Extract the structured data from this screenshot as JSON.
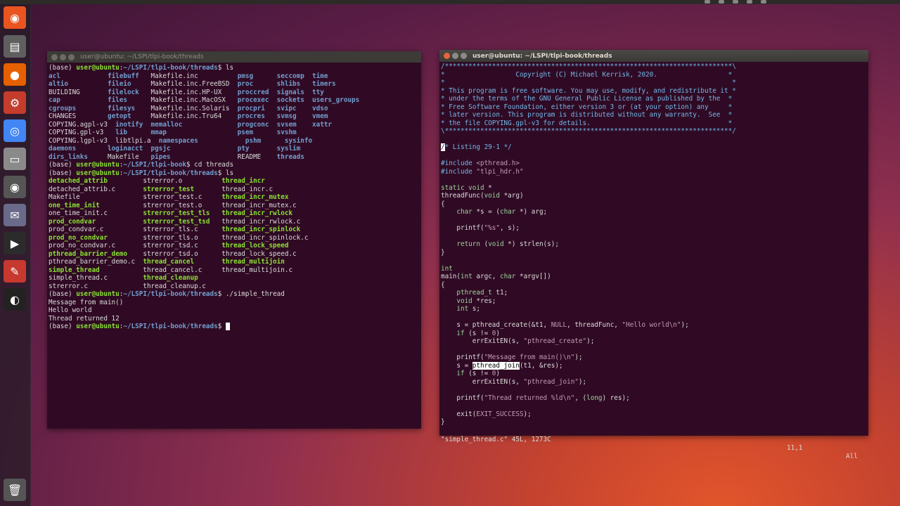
{
  "desktop": {
    "accent": "#e95420",
    "terminal_bg": "#300a24"
  },
  "launcher": {
    "items": [
      {
        "name": "ubuntu-dash-icon",
        "glyph": "◉"
      },
      {
        "name": "files-icon",
        "glyph": "▤"
      },
      {
        "name": "firefox-icon",
        "glyph": "●"
      },
      {
        "name": "settings-icon",
        "glyph": "⚙"
      },
      {
        "name": "chrome-icon",
        "glyph": "◎"
      },
      {
        "name": "drive-icon",
        "glyph": "▭"
      },
      {
        "name": "dvd-icon",
        "glyph": "◉"
      },
      {
        "name": "pidgin-icon",
        "glyph": "✉"
      },
      {
        "name": "terminal-icon",
        "glyph": "▶"
      },
      {
        "name": "text-editor-icon",
        "glyph": "✎"
      },
      {
        "name": "obs-icon",
        "glyph": "◐"
      },
      {
        "name": "trash-icon",
        "glyph": "🗑"
      }
    ]
  },
  "left_window": {
    "title": "user@ubuntu: ~/LSPI/tlpi-book/threads",
    "prompt_user": "user@ubuntu",
    "lines": [
      [
        {
          "c": "d",
          "t": "(base) "
        },
        {
          "c": "g",
          "t": "user@ubuntu"
        },
        {
          "c": "d",
          "t": ":"
        },
        {
          "c": "b",
          "t": "~/LSPI/tlpi-book/threads"
        },
        {
          "c": "d",
          "t": "$ ls"
        }
      ],
      [
        {
          "c": "b",
          "t": "acl            "
        },
        {
          "c": "b",
          "t": "filebuff   "
        },
        {
          "c": "d",
          "t": "Makefile.inc          "
        },
        {
          "c": "b",
          "t": "pmsg      "
        },
        {
          "c": "b",
          "t": "seccomp  "
        },
        {
          "c": "b",
          "t": "time"
        }
      ],
      [
        {
          "c": "b",
          "t": "altio          "
        },
        {
          "c": "b",
          "t": "fileio     "
        },
        {
          "c": "d",
          "t": "Makefile.inc.FreeBSD  "
        },
        {
          "c": "b",
          "t": "proc      "
        },
        {
          "c": "b",
          "t": "shlibs   "
        },
        {
          "c": "b",
          "t": "timers"
        }
      ],
      [
        {
          "c": "d",
          "t": "BUILDING       "
        },
        {
          "c": "b",
          "t": "filelock   "
        },
        {
          "c": "d",
          "t": "Makefile.inc.HP-UX    "
        },
        {
          "c": "b",
          "t": "proccred  "
        },
        {
          "c": "b",
          "t": "signals  "
        },
        {
          "c": "b",
          "t": "tty"
        }
      ],
      [
        {
          "c": "b",
          "t": "cap            "
        },
        {
          "c": "b",
          "t": "files      "
        },
        {
          "c": "d",
          "t": "Makefile.inc.MacOSX   "
        },
        {
          "c": "b",
          "t": "procexec  "
        },
        {
          "c": "b",
          "t": "sockets  "
        },
        {
          "c": "b",
          "t": "users_groups"
        }
      ],
      [
        {
          "c": "b",
          "t": "cgroups        "
        },
        {
          "c": "b",
          "t": "filesys    "
        },
        {
          "c": "d",
          "t": "Makefile.inc.Solaris  "
        },
        {
          "c": "b",
          "t": "procpri   "
        },
        {
          "c": "b",
          "t": "svipc    "
        },
        {
          "c": "b",
          "t": "vdso"
        }
      ],
      [
        {
          "c": "d",
          "t": "CHANGES        "
        },
        {
          "c": "b",
          "t": "getopt     "
        },
        {
          "c": "d",
          "t": "Makefile.inc.Tru64    "
        },
        {
          "c": "b",
          "t": "procres   "
        },
        {
          "c": "b",
          "t": "svmsg    "
        },
        {
          "c": "b",
          "t": "vmem"
        }
      ],
      [
        {
          "c": "d",
          "t": "COPYING.agpl-v3  "
        },
        {
          "c": "b",
          "t": "inotify  "
        },
        {
          "c": "b",
          "t": "memalloc              "
        },
        {
          "c": "b",
          "t": "progconc  "
        },
        {
          "c": "b",
          "t": "svsem    "
        },
        {
          "c": "b",
          "t": "xattr"
        }
      ],
      [
        {
          "c": "d",
          "t": "COPYING.gpl-v3   "
        },
        {
          "c": "b",
          "t": "lib      "
        },
        {
          "c": "b",
          "t": "mmap                  "
        },
        {
          "c": "b",
          "t": "psem      "
        },
        {
          "c": "b",
          "t": "svshm"
        }
      ],
      [
        {
          "c": "d",
          "t": "COPYING.lgpl-v3  "
        },
        {
          "c": "d",
          "t": "libtlpi.a  "
        },
        {
          "c": "b",
          "t": "namespaces            "
        },
        {
          "c": "b",
          "t": "pshm      "
        },
        {
          "c": "b",
          "t": "sysinfo"
        }
      ],
      [
        {
          "c": "b",
          "t": "daemons        "
        },
        {
          "c": "b",
          "t": "loginacct  "
        },
        {
          "c": "b",
          "t": "pgsjc                 "
        },
        {
          "c": "b",
          "t": "pty       "
        },
        {
          "c": "b",
          "t": "syslim"
        }
      ],
      [
        {
          "c": "b",
          "t": "dirs_links     "
        },
        {
          "c": "d",
          "t": "Makefile   "
        },
        {
          "c": "b",
          "t": "pipes                 "
        },
        {
          "c": "d",
          "t": "README    "
        },
        {
          "c": "b",
          "t": "threads"
        }
      ],
      [
        {
          "c": "d",
          "t": "(base) "
        },
        {
          "c": "g",
          "t": "user@ubuntu"
        },
        {
          "c": "d",
          "t": ":"
        },
        {
          "c": "b",
          "t": "~/LSPI/tlpi-book"
        },
        {
          "c": "d",
          "t": "$ cd threads"
        }
      ],
      [
        {
          "c": "d",
          "t": "(base) "
        },
        {
          "c": "g",
          "t": "user@ubuntu"
        },
        {
          "c": "d",
          "t": ":"
        },
        {
          "c": "b",
          "t": "~/LSPI/tlpi-book/threads"
        },
        {
          "c": "d",
          "t": "$ ls"
        }
      ],
      [
        {
          "c": "pl",
          "t": "detached_attrib         "
        },
        {
          "c": "d",
          "t": "strerror.o          "
        },
        {
          "c": "pl",
          "t": "thread_incr"
        }
      ],
      [
        {
          "c": "d",
          "t": "detached_attrib.c       "
        },
        {
          "c": "pl",
          "t": "strerror_test       "
        },
        {
          "c": "d",
          "t": "thread_incr.c"
        }
      ],
      [
        {
          "c": "d",
          "t": "Makefile                "
        },
        {
          "c": "d",
          "t": "strerror_test.c     "
        },
        {
          "c": "pl",
          "t": "thread_incr_mutex"
        }
      ],
      [
        {
          "c": "pl",
          "t": "one_time_init           "
        },
        {
          "c": "d",
          "t": "strerror_test.o     "
        },
        {
          "c": "d",
          "t": "thread_incr_mutex.c"
        }
      ],
      [
        {
          "c": "d",
          "t": "one_time_init.c         "
        },
        {
          "c": "pl",
          "t": "strerror_test_tls   "
        },
        {
          "c": "pl",
          "t": "thread_incr_rwlock"
        }
      ],
      [
        {
          "c": "pl",
          "t": "prod_condvar            "
        },
        {
          "c": "pl",
          "t": "strerror_test_tsd   "
        },
        {
          "c": "d",
          "t": "thread_incr_rwlock.c"
        }
      ],
      [
        {
          "c": "d",
          "t": "prod_condvar.c          "
        },
        {
          "c": "d",
          "t": "strerror_tls.c      "
        },
        {
          "c": "pl",
          "t": "thread_incr_spinlock"
        }
      ],
      [
        {
          "c": "pl",
          "t": "prod_no_condvar         "
        },
        {
          "c": "d",
          "t": "strerror_tls.o      "
        },
        {
          "c": "d",
          "t": "thread_incr_spinlock.c"
        }
      ],
      [
        {
          "c": "d",
          "t": "prod_no_condvar.c       "
        },
        {
          "c": "d",
          "t": "strerror_tsd.c      "
        },
        {
          "c": "pl",
          "t": "thread_lock_speed"
        }
      ],
      [
        {
          "c": "pl",
          "t": "pthread_barrier_demo    "
        },
        {
          "c": "d",
          "t": "strerror_tsd.o      "
        },
        {
          "c": "d",
          "t": "thread_lock_speed.c"
        }
      ],
      [
        {
          "c": "d",
          "t": "pthread_barrier_demo.c  "
        },
        {
          "c": "pl",
          "t": "thread_cancel       "
        },
        {
          "c": "pl",
          "t": "thread_multijoin"
        }
      ],
      [
        {
          "c": "pl",
          "t": "simple_thread           "
        },
        {
          "c": "d",
          "t": "thread_cancel.c     "
        },
        {
          "c": "d",
          "t": "thread_multijoin.c"
        }
      ],
      [
        {
          "c": "d",
          "t": "simple_thread.c         "
        },
        {
          "c": "pl",
          "t": "thread_cleanup"
        }
      ],
      [
        {
          "c": "d",
          "t": "strerror.c              "
        },
        {
          "c": "d",
          "t": "thread_cleanup.c"
        }
      ],
      [
        {
          "c": "d",
          "t": "(base) "
        },
        {
          "c": "g",
          "t": "user@ubuntu"
        },
        {
          "c": "d",
          "t": ":"
        },
        {
          "c": "b",
          "t": "~/LSPI/tlpi-book/threads"
        },
        {
          "c": "d",
          "t": "$ ./simple_thread"
        }
      ],
      [
        {
          "c": "d",
          "t": "Message from main()"
        }
      ],
      [
        {
          "c": "d",
          "t": "Hello world"
        }
      ],
      [
        {
          "c": "d",
          "t": "Thread returned 12"
        }
      ],
      [
        {
          "c": "d",
          "t": "(base) "
        },
        {
          "c": "g",
          "t": "user@ubuntu"
        },
        {
          "c": "d",
          "t": ":"
        },
        {
          "c": "b",
          "t": "~/LSPI/tlpi-book/threads"
        },
        {
          "c": "d",
          "t": "$ "
        },
        {
          "c": "cur",
          "t": " "
        }
      ]
    ]
  },
  "right_window": {
    "title": "user@ubuntu: ~/LSPI/tlpi-book/threads",
    "lines": [
      [
        {
          "c": "cm",
          "t": "/*************************************************************************\\"
        }
      ],
      [
        {
          "c": "cm",
          "t": "*                  Copyright (C) Michael Kerrisk, 2020.                  *"
        }
      ],
      [
        {
          "c": "cm",
          "t": "*                                                                         *"
        }
      ],
      [
        {
          "c": "cm",
          "t": "* This program is free software. You may use, modify, and redistribute it *"
        }
      ],
      [
        {
          "c": "cm",
          "t": "* under the terms of the GNU General Public License as published by the  *"
        }
      ],
      [
        {
          "c": "cm",
          "t": "* Free Software Foundation, either version 3 or (at your option) any     *"
        }
      ],
      [
        {
          "c": "cm",
          "t": "* later version. This program is distributed without any warranty.  See  *"
        }
      ],
      [
        {
          "c": "cm",
          "t": "* the file COPYING.gpl-v3 for details.                                   *"
        }
      ],
      [
        {
          "c": "cm",
          "t": "\\*************************************************************************/"
        }
      ],
      [
        {
          "c": "d",
          "t": ""
        }
      ],
      [
        {
          "c": "cur",
          "t": "/"
        },
        {
          "c": "cm",
          "t": "* Listing 29-1 */"
        }
      ],
      [
        {
          "c": "d",
          "t": ""
        }
      ],
      [
        {
          "c": "cm",
          "t": "#include "
        },
        {
          "c": "inc",
          "t": "<pthread.h>"
        }
      ],
      [
        {
          "c": "cm",
          "t": "#include "
        },
        {
          "c": "inc",
          "t": "\"tlpi_hdr.h\""
        }
      ],
      [
        {
          "c": "d",
          "t": ""
        }
      ],
      [
        {
          "c": "ty",
          "t": "static void"
        },
        {
          "c": "d",
          "t": " *"
        }
      ],
      [
        {
          "c": "d",
          "t": "threadFunc("
        },
        {
          "c": "ty",
          "t": "void"
        },
        {
          "c": "d",
          "t": " *arg)"
        }
      ],
      [
        {
          "c": "d",
          "t": "{"
        }
      ],
      [
        {
          "c": "d",
          "t": "    "
        },
        {
          "c": "ty",
          "t": "char"
        },
        {
          "c": "d",
          "t": " *s = ("
        },
        {
          "c": "ty",
          "t": "char"
        },
        {
          "c": "d",
          "t": " *) arg;"
        }
      ],
      [
        {
          "c": "d",
          "t": ""
        }
      ],
      [
        {
          "c": "d",
          "t": "    printf("
        },
        {
          "c": "str",
          "t": "\"%s\""
        },
        {
          "c": "d",
          "t": ", s);"
        }
      ],
      [
        {
          "c": "d",
          "t": ""
        }
      ],
      [
        {
          "c": "d",
          "t": "    "
        },
        {
          "c": "ty",
          "t": "return"
        },
        {
          "c": "d",
          "t": " ("
        },
        {
          "c": "ty",
          "t": "void"
        },
        {
          "c": "d",
          "t": " *) strlen(s);"
        }
      ],
      [
        {
          "c": "d",
          "t": "}"
        }
      ],
      [
        {
          "c": "d",
          "t": ""
        }
      ],
      [
        {
          "c": "ty",
          "t": "int"
        }
      ],
      [
        {
          "c": "d",
          "t": "main("
        },
        {
          "c": "ty",
          "t": "int"
        },
        {
          "c": "d",
          "t": " argc, "
        },
        {
          "c": "ty",
          "t": "char"
        },
        {
          "c": "d",
          "t": " *argv[])"
        }
      ],
      [
        {
          "c": "d",
          "t": "{"
        }
      ],
      [
        {
          "c": "d",
          "t": "    "
        },
        {
          "c": "ty",
          "t": "pthread_t"
        },
        {
          "c": "d",
          "t": " t1;"
        }
      ],
      [
        {
          "c": "d",
          "t": "    "
        },
        {
          "c": "ty",
          "t": "void"
        },
        {
          "c": "d",
          "t": " *res;"
        }
      ],
      [
        {
          "c": "d",
          "t": "    "
        },
        {
          "c": "ty",
          "t": "int"
        },
        {
          "c": "d",
          "t": " s;"
        }
      ],
      [
        {
          "c": "d",
          "t": ""
        }
      ],
      [
        {
          "c": "d",
          "t": "    s = pthread_create(&t1, "
        },
        {
          "c": "str",
          "t": "NULL"
        },
        {
          "c": "d",
          "t": ", threadFunc, "
        },
        {
          "c": "str",
          "t": "\"Hello world\\n\""
        },
        {
          "c": "d",
          "t": ");"
        }
      ],
      [
        {
          "c": "d",
          "t": "    "
        },
        {
          "c": "ty",
          "t": "if"
        },
        {
          "c": "d",
          "t": " (s != "
        },
        {
          "c": "str",
          "t": "0"
        },
        {
          "c": "d",
          "t": ")"
        }
      ],
      [
        {
          "c": "d",
          "t": "        errExitEN(s, "
        },
        {
          "c": "str",
          "t": "\"pthread_create\""
        },
        {
          "c": "d",
          "t": ");"
        }
      ],
      [
        {
          "c": "d",
          "t": ""
        }
      ],
      [
        {
          "c": "d",
          "t": "    printf("
        },
        {
          "c": "str",
          "t": "\"Message from main()\\n\""
        },
        {
          "c": "d",
          "t": ");"
        }
      ],
      [
        {
          "c": "d",
          "t": "    s = "
        },
        {
          "c": "hl",
          "t": "pthread_join"
        },
        {
          "c": "d",
          "t": "(t1, &res);"
        }
      ],
      [
        {
          "c": "d",
          "t": "    "
        },
        {
          "c": "ty",
          "t": "if"
        },
        {
          "c": "d",
          "t": " (s != "
        },
        {
          "c": "str",
          "t": "0"
        },
        {
          "c": "d",
          "t": ")"
        }
      ],
      [
        {
          "c": "d",
          "t": "        errExitEN(s, "
        },
        {
          "c": "str",
          "t": "\"pthread_join\""
        },
        {
          "c": "d",
          "t": ");"
        }
      ],
      [
        {
          "c": "d",
          "t": ""
        }
      ],
      [
        {
          "c": "d",
          "t": "    printf("
        },
        {
          "c": "str",
          "t": "\"Thread returned %ld\\n\""
        },
        {
          "c": "d",
          "t": ", ("
        },
        {
          "c": "ty",
          "t": "long"
        },
        {
          "c": "d",
          "t": ") res);"
        }
      ],
      [
        {
          "c": "d",
          "t": ""
        }
      ],
      [
        {
          "c": "d",
          "t": "    exit("
        },
        {
          "c": "str",
          "t": "EXIT_SUCCESS"
        },
        {
          "c": "d",
          "t": ");"
        }
      ],
      [
        {
          "c": "d",
          "t": "}"
        }
      ]
    ],
    "status": {
      "file": "\"simple_thread.c\" 45L, 1273C",
      "position": "11,1",
      "scroll": "All"
    }
  }
}
